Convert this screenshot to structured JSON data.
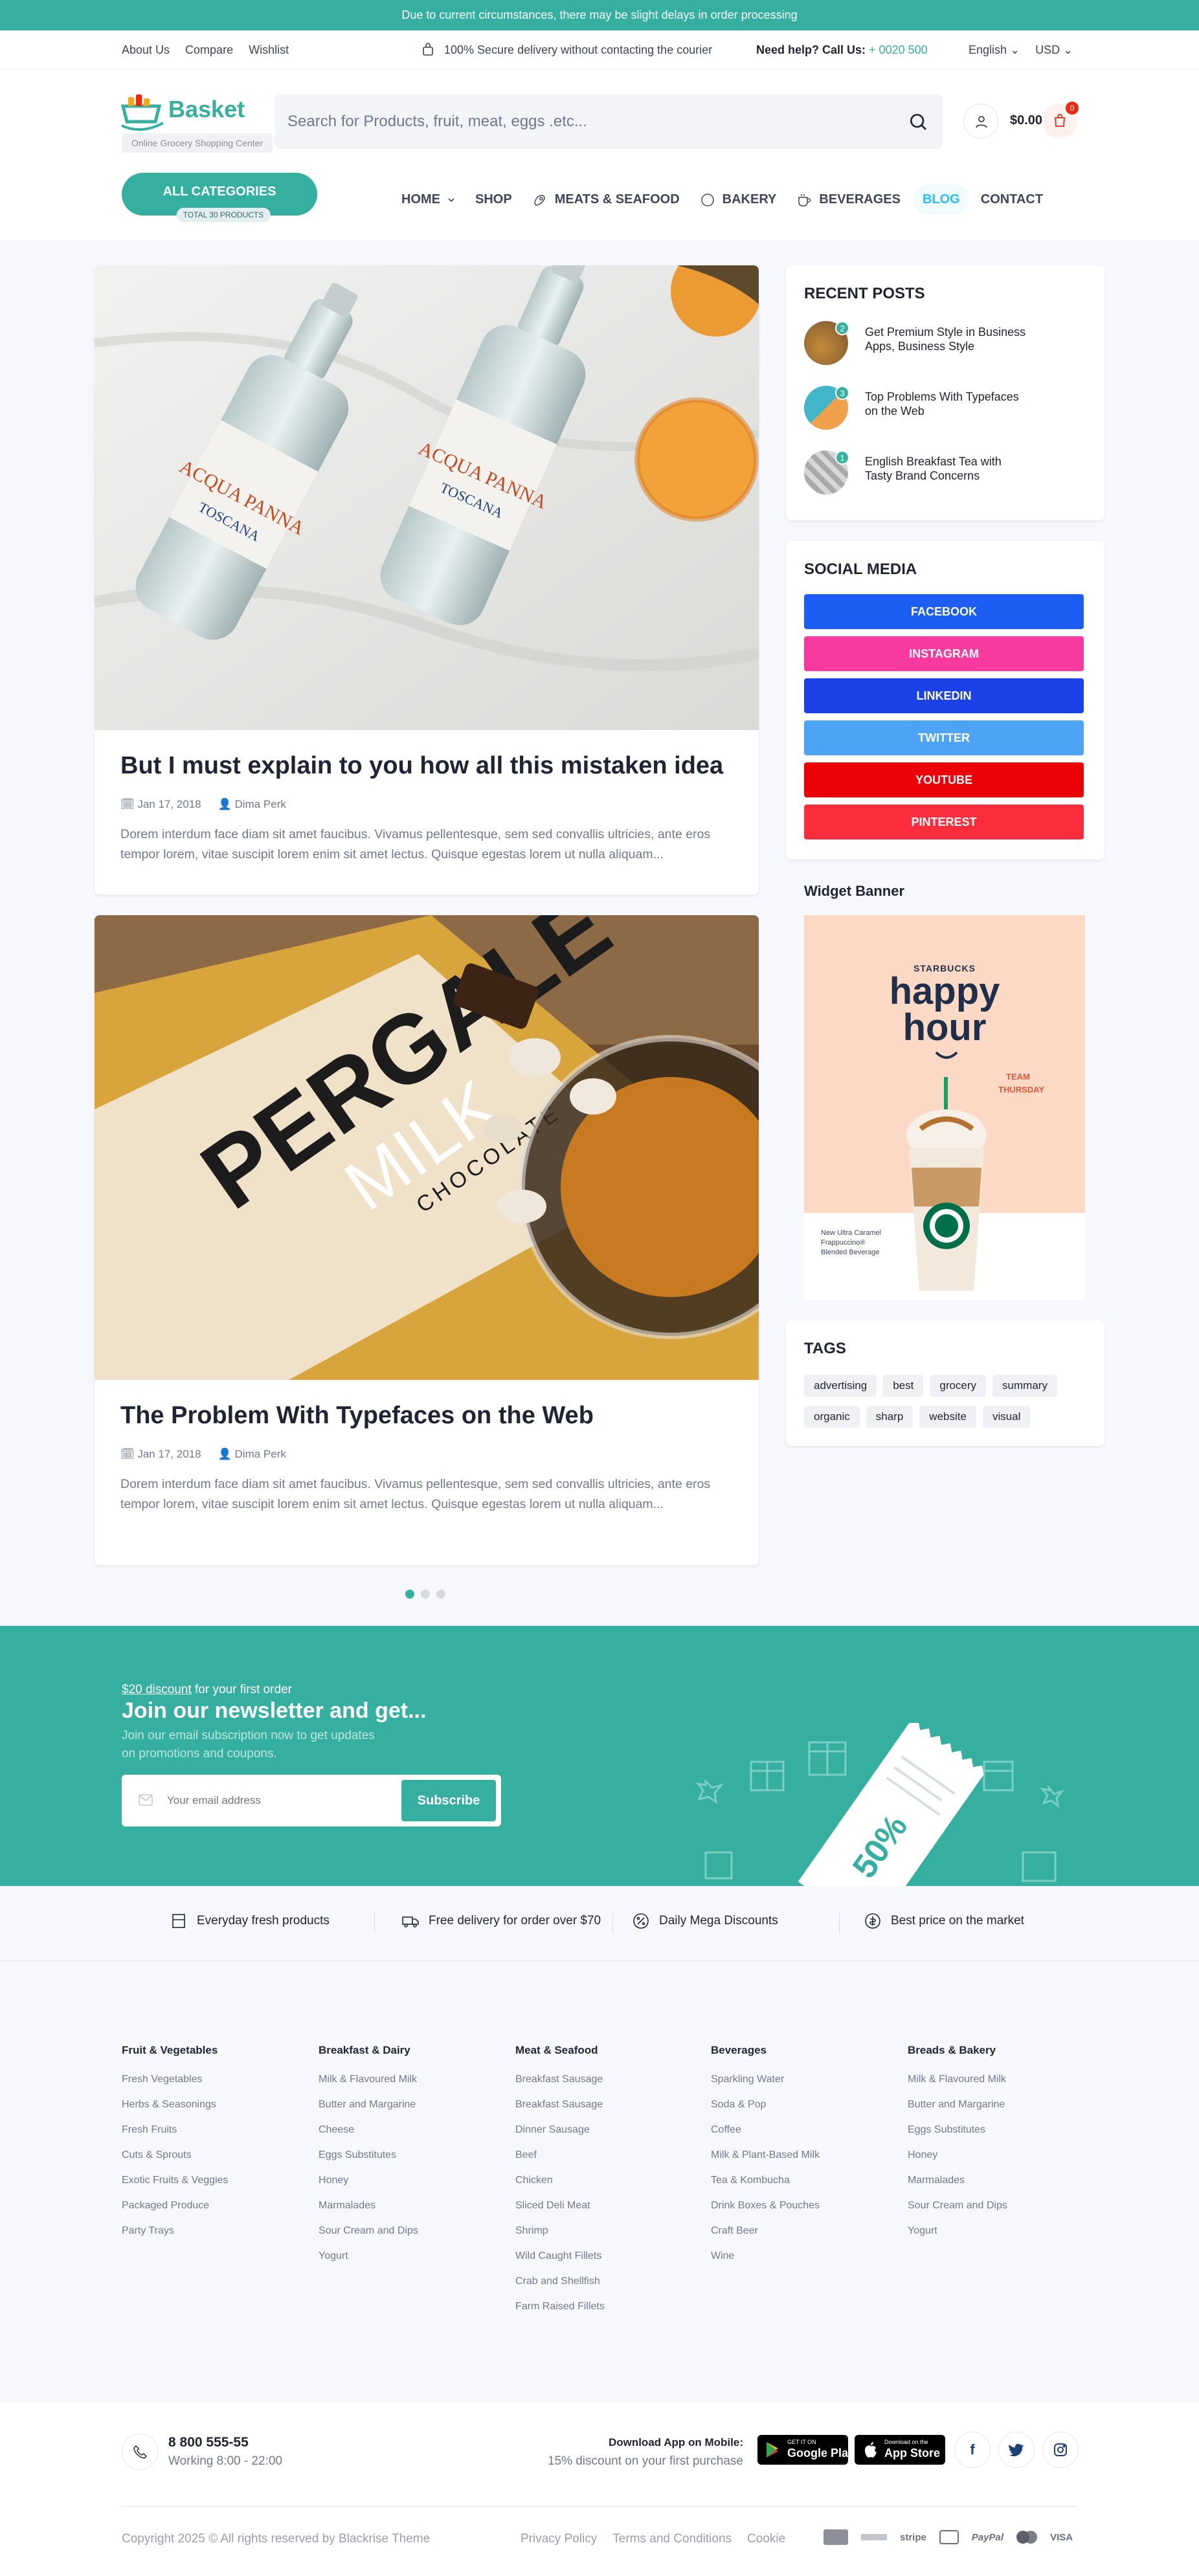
{
  "topbar": {
    "message": "Due to current circumstances, there may be slight delays in order processing"
  },
  "util": {
    "links": [
      "About Us",
      "Compare",
      "Wishlist"
    ],
    "secure": "100% Secure delivery without contacting the courier",
    "help_label": "Need help? Call Us:",
    "help_phone": "+ 0020 500",
    "language": "English",
    "currency": "USD"
  },
  "logo": {
    "name": "Basket",
    "tagline": "Online Grocery Shopping Center"
  },
  "search": {
    "placeholder": "Search for Products, fruit, meat, eggs .etc..."
  },
  "cart": {
    "amount": "$0.00",
    "count": "0"
  },
  "categories": {
    "label": "ALL CATEGORIES",
    "sub": "TOTAL 30 PRODUCTS"
  },
  "nav": [
    "HOME",
    "SHOP",
    "MEATS & SEAFOOD",
    "BAKERY",
    "BEVERAGES",
    "BLOG",
    "CONTACT"
  ],
  "posts": [
    {
      "title": "But I must explain to you how all this mistaken idea",
      "date": "Jan 17, 2018",
      "author": "Dima Perk",
      "excerpt": "Dorem interdum face diam sit amet faucibus. Vivamus pellentesque, sem sed convallis ultricies, ante eros tempor lorem, vitae suscipit lorem enim sit amet lectus. Quisque egestas lorem ut nulla aliquam...",
      "image_label_1": "ACQUA PANNA",
      "image_label_2": "TOSCANA"
    },
    {
      "title": "The Problem With Typefaces on the Web",
      "date": "Jan 17, 2018",
      "author": "Dima Perk",
      "excerpt": "Dorem interdum face diam sit amet faucibus. Vivamus pellentesque, sem sed convallis ultricies, ante eros tempor lorem, vitae suscipit lorem enim sit amet lectus. Quisque egestas lorem ut nulla aliquam...",
      "image_label_1": "PERGALE",
      "image_label_2": "MILK",
      "image_label_3": "CHOCOLATE"
    }
  ],
  "pagination": {
    "pages": 3,
    "current": 1
  },
  "sidebar": {
    "recent_title": "RECENT POSTS",
    "recent": [
      {
        "num": "2",
        "title": "Get Premium Style in Business Apps, Business Style"
      },
      {
        "num": "3",
        "title": "Top Problems With Typefaces on the Web"
      },
      {
        "num": "1",
        "title": "English Breakfast Tea with Tasty Brand Concerns"
      }
    ],
    "social_title": "SOCIAL MEDIA",
    "social": [
      {
        "label": "FACEBOOK",
        "color": "#1c5df4"
      },
      {
        "label": "INSTAGRAM",
        "color": "#f83aa0"
      },
      {
        "label": "LINKEDIN",
        "color": "#1d41e8"
      },
      {
        "label": "TWITTER",
        "color": "#4da3f5"
      },
      {
        "label": "YOUTUBE",
        "color": "#ec0109"
      },
      {
        "label": "PINTEREST",
        "color": "#fb2d3d"
      }
    ],
    "banner_title": "Widget Banner",
    "banner": {
      "brand": "STARBUCKS",
      "line1": "happy",
      "line2": "hour",
      "team1": "TEAM",
      "team2": "THURSDAY",
      "caption1": "New Ultra Caramel",
      "caption2": "Frappuccino®",
      "caption3": "Blended Beverage"
    },
    "tags_title": "TAGS",
    "tags": [
      "advertising",
      "best",
      "grocery",
      "summary",
      "organic",
      "sharp",
      "website",
      "visual"
    ]
  },
  "newsletter": {
    "discount": "$20 discount",
    "discount_rest": " for your first order",
    "title": "Join our newsletter and get...",
    "desc1": "Join our email subscription now to get updates",
    "desc2": "on promotions and coupons.",
    "placeholder": "Your email address",
    "button": "Subscribe",
    "coupon": "50%"
  },
  "features": [
    "Everyday fresh products",
    "Free delivery for order over $70",
    "Daily Mega Discounts",
    "Best price on the market"
  ],
  "footer_cols": [
    {
      "title": "Fruit & Vegetables",
      "items": [
        "Fresh Vegetables",
        "Herbs & Seasonings",
        "Fresh Fruits",
        "Cuts & Sprouts",
        "Exotic Fruits & Veggies",
        "Packaged Produce",
        "Party Trays"
      ]
    },
    {
      "title": "Breakfast & Dairy",
      "items": [
        "Milk & Flavoured Milk",
        "Butter and Margarine",
        "Cheese",
        "Eggs Substitutes",
        "Honey",
        "Marmalades",
        "Sour Cream and Dips",
        "Yogurt"
      ]
    },
    {
      "title": "Meat & Seafood",
      "items": [
        "Breakfast Sausage",
        "Breakfast Sausage",
        "Dinner Sausage",
        "Beef",
        "Chicken",
        "Sliced Deli Meat",
        "Shrimp",
        "Wild Caught Fillets",
        "Crab and Shellfish",
        "Farm Raised Fillets"
      ]
    },
    {
      "title": "Beverages",
      "items": [
        "Sparkling Water",
        "Soda & Pop",
        "Coffee",
        "Milk & Plant-Based Milk",
        "Tea & Kombucha",
        "Drink Boxes & Pouches",
        "Craft Beer",
        "Wine"
      ]
    },
    {
      "title": "Breads & Bakery",
      "items": [
        "Milk & Flavoured Milk",
        "Butter and Margarine",
        "Eggs Substitutes",
        "Honey",
        "Marmalades",
        "Sour Cream and Dips",
        "Yogurt"
      ]
    }
  ],
  "contact": {
    "phone": "8 800 555-55",
    "hours": "Working 8:00 - 22:00"
  },
  "app": {
    "title": "Download App on Mobile:",
    "sub": "15% discount on your first purchase",
    "google_small": "GET IT ON",
    "google": "Google Play",
    "apple_small": "Download on the",
    "apple": "App Store"
  },
  "copyright": "Copyright 2025 © All rights reserved by Blackrise Theme",
  "legal": [
    "Privacy Policy",
    "Terms and Conditions",
    "Cookie"
  ],
  "payments": [
    "stripe",
    "PayPal",
    "VISA"
  ]
}
